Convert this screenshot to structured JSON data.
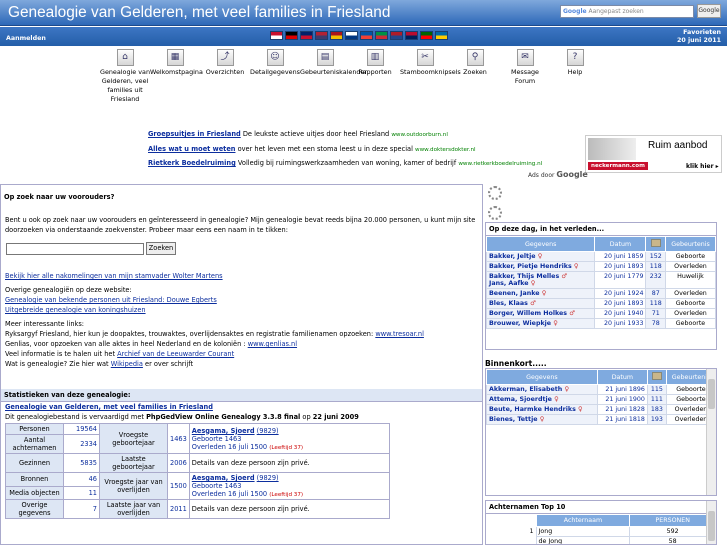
{
  "header": {
    "title": "Genealogie van Gelderen, met veel families in Friesland",
    "search_placeholder": "Aangepast zoeken",
    "search_brand": "Google",
    "search_button": "Google"
  },
  "bar": {
    "login": "Aanmelden",
    "favorites": "Favorieten",
    "date": "20 juni 2011",
    "flags": [
      {
        "name": "flag-denmark",
        "c1": "#c8102e",
        "c2": "#ffffff"
      },
      {
        "name": "flag-germany",
        "c1": "#000000",
        "c2": "#dd0000"
      },
      {
        "name": "flag-uk",
        "c1": "#012169",
        "c2": "#c8102e"
      },
      {
        "name": "flag-usa",
        "c1": "#b22234",
        "c2": "#3c3b6e"
      },
      {
        "name": "flag-spain",
        "c1": "#aa151b",
        "c2": "#f1bf00"
      },
      {
        "name": "flag-finland",
        "c1": "#ffffff",
        "c2": "#003580"
      },
      {
        "name": "flag-france",
        "c1": "#0055a4",
        "c2": "#ef4135"
      },
      {
        "name": "flag-italy",
        "c1": "#009246",
        "c2": "#ce2b37"
      },
      {
        "name": "flag-netherlands",
        "c1": "#ae1c28",
        "c2": "#21468b"
      },
      {
        "name": "flag-norway",
        "c1": "#ba0c2f",
        "c2": "#00205b"
      },
      {
        "name": "flag-portugal",
        "c1": "#006600",
        "c2": "#ff0000"
      },
      {
        "name": "flag-sweden",
        "c1": "#006aa7",
        "c2": "#fecc00"
      }
    ]
  },
  "menu": [
    {
      "name": "menu-genealogie",
      "icon": "home-icon",
      "glyph": "⌂",
      "label": "Genealogie van Gelderen, veel families uit Friesland"
    },
    {
      "name": "menu-welkomstpagina",
      "icon": "portal-icon",
      "glyph": "▦",
      "label": "Welkomstpagina"
    },
    {
      "name": "menu-overzichten",
      "icon": "chart-icon",
      "glyph": "⤴",
      "label": "Overzichten"
    },
    {
      "name": "menu-detailgegevens",
      "icon": "person-icon",
      "glyph": "☺",
      "label": "Detailgegevens"
    },
    {
      "name": "menu-gebeurteniskalender",
      "icon": "calendar-icon",
      "glyph": "▤",
      "label": "Gebeurteniskalender"
    },
    {
      "name": "menu-rapporten",
      "icon": "report-icon",
      "glyph": "▥",
      "label": "Rapporten"
    },
    {
      "name": "menu-stamboomknipsels",
      "icon": "clippings-icon",
      "glyph": "✂",
      "label": "Stamboomknipsels"
    },
    {
      "name": "menu-zoeken",
      "icon": "magnifier-icon",
      "glyph": "⚲",
      "label": "Zoeken"
    },
    {
      "name": "menu-message-forum",
      "icon": "forum-icon",
      "glyph": "✉",
      "label": "Message Forum"
    },
    {
      "name": "menu-help",
      "icon": "help-icon",
      "glyph": "?",
      "label": "Help"
    }
  ],
  "ads": [
    {
      "title": "Groepsuitjes in Friesland",
      "text": "De leukste actieve uitjes door heel Friesland",
      "url": "www.outdoorburn.nl"
    },
    {
      "title": "Alles wat u moet weten",
      "text": "over het leven met een stoma leest u in deze special",
      "url": "www.doktersdokter.nl"
    },
    {
      "title": "Rietkerk Boedelruiming",
      "text": "Volledig bij ruimingswerkzaamheden van woning, kamer of bedrijf",
      "url": "www.rietkerkboedelruiming.nl"
    }
  ],
  "banner": {
    "headline": "Ruim aanbod",
    "logo": "neckermann.com",
    "cta": "klik hier ▸"
  },
  "ads_by": {
    "prefix": "Ads door",
    "brand": "Google"
  },
  "search_section": {
    "heading": "Op zoek naar uw voorouders?",
    "intro": "Bent u ook op zoek naar uw voorouders en geïnteresseerd in genealogie? Mijn genealogie bevat reeds bijna 20.000 personen, u kunt mijn site doorzoeken via onderstaande zoekvenster. Probeer maar eens een naam in te tikken:",
    "button": "Zoeken",
    "link1": "Bekijk hier alle nakomelingen van mijn stamvader Wolter Martens",
    "other_label": "Overige genealogiën op deze website:",
    "link2": "Genealogie van bekende personen uit Friesland: Douwe Egberts",
    "link3": "Uitgebreide genealogie van koningshuizen",
    "more_label": "Meer interessante links:",
    "ryksargyf": "Ryksargyf Friesland, hier kun je doopaktes, trouwaktes, overlijdensaktes en registratie familienamen opzoeken:",
    "ryksargyf_link": "www.tresoar.nl",
    "genlias": "Genlias, voor opzoeken van alle aktes in heel Nederland en de koloniën :",
    "genlias_link": "www.genlias.nl",
    "krant_prefix": "Veel informatie is te halen uit het",
    "krant_link": "Archief van de Leeuwarder Courant",
    "wat_prefix": "Wat is genealogie? Zie hier wat",
    "wat_link": "Wikipedia",
    "wat_suffix": "er over schrijft"
  },
  "stats": {
    "heading": "Statistieken van deze genealogie:",
    "title_link": "Genealogie van Gelderen, met veel families in Friesland",
    "prefix": "Dit genealogiebestand is vervaardigd met",
    "software": "PhpGedView Online Genealogy 3.3.8 final",
    "on": "op",
    "date": "22 juni 2009",
    "counts": [
      {
        "label": "Personen",
        "value": "19564"
      },
      {
        "label": "Aantal achternamen",
        "value": "2334"
      },
      {
        "label": "Gezinnen",
        "value": "5835"
      },
      {
        "label": "Bronnen",
        "value": "46"
      },
      {
        "label": "Media objecten",
        "value": "11"
      },
      {
        "label": "Overige gegevens",
        "value": "7"
      }
    ],
    "facts": [
      {
        "label": "Vroegste geboortejaar",
        "year": "1463",
        "name": "Aesgama, Sjoerd",
        "id": "(9829)",
        "line1": "Geboorte 1463",
        "line2": "Overleden 16 juli 1500",
        "age": "(Leeftijd 37)"
      },
      {
        "label": "Laatste geboortejaar",
        "year": "2006",
        "text": "Details van deze persoon zijn privé."
      },
      {
        "label": "Vroegste jaar van overlijden",
        "year": "1500",
        "name": "Aesgama, Sjoerd",
        "id": "(9829)",
        "line1": "Geboorte 1463",
        "line2": "Overleden 16 juli 1500",
        "age": "(Leeftijd 37)"
      },
      {
        "label": "Laatste jaar van overlijden",
        "year": "2011",
        "text": "Details van deze persoon zijn privé."
      }
    ]
  },
  "today": {
    "title": "Op deze dag, in het verleden...",
    "cols": [
      "Gegevens",
      "Datum",
      "Gebeurtenis"
    ],
    "rows": [
      {
        "name": "Bakker, Jeltje",
        "sex": "♀",
        "date": "20 juni 1859",
        "age": "152",
        "event": "Geboorte"
      },
      {
        "name": "Bakker, Pietje Hendriks",
        "sex": "♀",
        "date": "20 juni 1893",
        "age": "118",
        "event": "Overleden"
      },
      {
        "name": "Bakker, Thijs Melles",
        "sex": "♂",
        "name2": "Jans, Aafke",
        "sex2": "♀",
        "date": "20 juni 1779",
        "age": "232",
        "event": "Huwelijk"
      },
      {
        "name": "Beenen, Janke",
        "sex": "♀",
        "date": "20 juni 1924",
        "age": "87",
        "event": "Overleden"
      },
      {
        "name": "Bles, Klaas",
        "sex": "♂",
        "date": "20 juni 1893",
        "age": "118",
        "event": "Geboorte"
      },
      {
        "name": "Borger, Willem Holkes",
        "sex": "♂",
        "date": "20 juni 1940",
        "age": "71",
        "event": "Overleden"
      },
      {
        "name": "Brouwer, Wiepkje",
        "sex": "♀",
        "date": "20 juni 1933",
        "age": "78",
        "event": "Geboorte"
      }
    ]
  },
  "soon": {
    "title": "Binnenkort.....",
    "cols": [
      "Gegevens",
      "Datum",
      "Gebeurtenis"
    ],
    "rows": [
      {
        "name": "Akkerman, Elisabeth",
        "sex": "♀",
        "date": "21 juni 1896",
        "age": "115",
        "event": "Geboorte"
      },
      {
        "name": "Attema, Sjoerdtje",
        "sex": "♀",
        "date": "21 juni 1900",
        "age": "111",
        "event": "Geboorte"
      },
      {
        "name": "Beute, Harmke Hendriks",
        "sex": "♀",
        "date": "21 juni 1828",
        "age": "183",
        "event": "Overleden"
      },
      {
        "name": "Bienes, Tettje",
        "sex": "♀",
        "date": "21 juni 1818",
        "age": "193",
        "event": "Overleden"
      }
    ]
  },
  "top10": {
    "title": "Achternamen Top 10",
    "cols": [
      "Achternaam",
      "PERSONEN"
    ],
    "rows": [
      {
        "rank": "1",
        "name": "Jong",
        "count": "592"
      },
      {
        "rank": "",
        "name": "de Jong",
        "count": "58"
      }
    ]
  }
}
